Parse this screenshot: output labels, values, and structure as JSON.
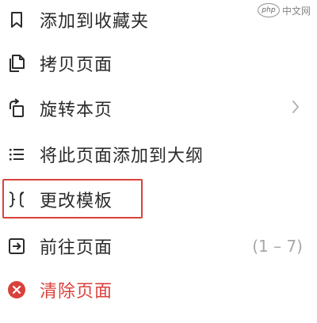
{
  "watermark": {
    "logo_text": "php",
    "site_text": "中文网"
  },
  "menu": {
    "items": [
      {
        "label": "添加到收藏夹",
        "icon": "bookmark-icon"
      },
      {
        "label": "拷贝页面",
        "icon": "copy-pages-icon"
      },
      {
        "label": "旋转本页",
        "icon": "rotate-page-icon",
        "trailing_icon": "chevron-right-icon"
      },
      {
        "label": "将此页面添加到大纲",
        "icon": "outline-list-icon"
      },
      {
        "label": "更改模板",
        "icon": "change-template-icon",
        "highlighted": true
      },
      {
        "label": "前往页面",
        "icon": "go-to-page-icon",
        "trailing_text": "(1 – 7)"
      },
      {
        "label": "清除页面",
        "icon": "clear-circle-icon",
        "danger": true
      }
    ]
  },
  "colors": {
    "text": "#2b2b2b",
    "muted": "#a8a8a8",
    "danger": "#d9413b",
    "highlight_border": "#d9413b"
  }
}
